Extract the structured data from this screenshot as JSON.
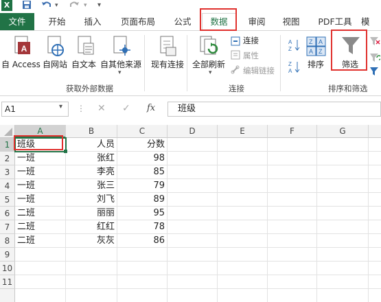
{
  "app": {
    "logo": "X"
  },
  "quick_access": {
    "save_icon": "save-icon",
    "undo_icon": "undo-icon",
    "redo_icon": "redo-icon"
  },
  "tabs": [
    {
      "label": "文件"
    },
    {
      "label": "开始"
    },
    {
      "label": "插入"
    },
    {
      "label": "页面布局"
    },
    {
      "label": "公式"
    },
    {
      "label": "数据"
    },
    {
      "label": "审阅"
    },
    {
      "label": "视图"
    },
    {
      "label": "PDF工具"
    },
    {
      "label": "模"
    }
  ],
  "ribbon": {
    "get_external": {
      "group_label": "获取外部数据",
      "buttons": [
        "自 Access",
        "自网站",
        "自文本",
        "自其他来源",
        "现有连接"
      ]
    },
    "connections": {
      "group_label": "连接",
      "refresh_label": "全部刷新",
      "small": [
        "连接",
        "属性",
        "编辑链接"
      ]
    },
    "sort_filter": {
      "group_label": "排序和筛选",
      "sort_label": "排序",
      "filter_label": "筛选"
    }
  },
  "formula_bar": {
    "name_box": "A1",
    "formula": "班级"
  },
  "columns": [
    "A",
    "B",
    "C",
    "D",
    "E",
    "F",
    "G"
  ],
  "rows": [
    "1",
    "2",
    "3",
    "4",
    "5",
    "6",
    "7",
    "8",
    "9",
    "10",
    "11"
  ],
  "table": [
    [
      "班级",
      "人员",
      "分数"
    ],
    [
      "一班",
      "张红",
      "98"
    ],
    [
      "一班",
      "李亮",
      "85"
    ],
    [
      "一班",
      "张三",
      "79"
    ],
    [
      "一班",
      "刘飞",
      "89"
    ],
    [
      "二班",
      "丽丽",
      "95"
    ],
    [
      "二班",
      "红红",
      "78"
    ],
    [
      "二班",
      "灰灰",
      "86"
    ]
  ],
  "colors": {
    "accent": "#217346",
    "highlight": "#e0302d"
  }
}
